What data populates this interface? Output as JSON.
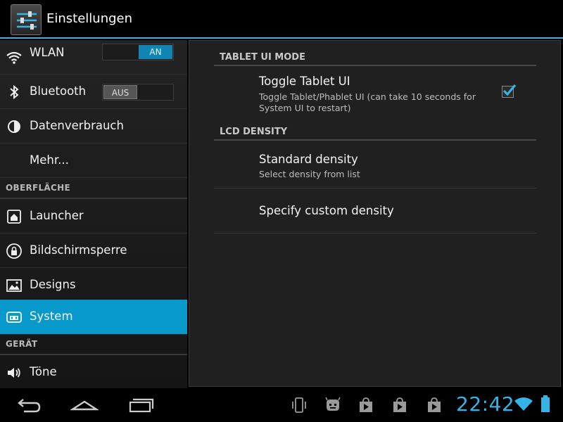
{
  "actionbar": {
    "title": "Einstellungen"
  },
  "sidebar": {
    "items": [
      {
        "label": "WLAN",
        "icon": "wifi-icon",
        "switch": "AN"
      },
      {
        "label": "Bluetooth",
        "icon": "bluetooth-icon",
        "switch": "AUS"
      },
      {
        "label": "Datenverbrauch",
        "icon": "data-usage-icon"
      },
      {
        "label": "Mehr..."
      },
      {
        "section": "OBERFLÄCHE"
      },
      {
        "label": "Launcher",
        "icon": "launcher-icon"
      },
      {
        "label": "Bildschirmsperre",
        "icon": "lockscreen-icon"
      },
      {
        "label": "Designs",
        "icon": "themes-icon"
      },
      {
        "label": "System",
        "icon": "system-icon",
        "selected": true
      },
      {
        "section": "GERÄT"
      },
      {
        "label": "Töne",
        "icon": "sound-icon"
      }
    ]
  },
  "content": {
    "categories": [
      "TABLET UI MODE",
      "LCD DENSITY"
    ],
    "prefs": [
      {
        "title": "Toggle Tablet UI",
        "summary": "Toggle Tablet/Phablet UI (can take 10 seconds for System UI to restart)",
        "checked": true
      },
      {
        "title": "Standard density",
        "summary": "Select density from list"
      },
      {
        "title": "Specify custom density"
      }
    ]
  },
  "statusbar": {
    "clock": "22:42",
    "accent": "#33b5e5",
    "selected": "#0899cc"
  }
}
